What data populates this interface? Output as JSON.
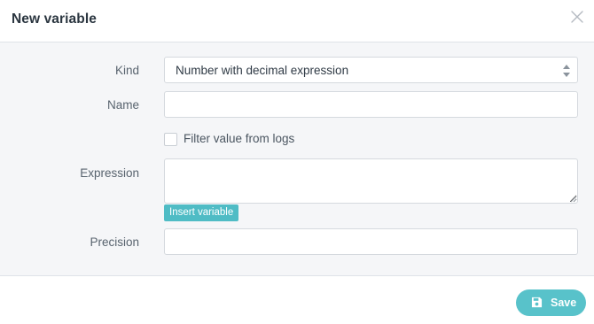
{
  "dialog": {
    "title": "New variable",
    "close_icon": "close-icon"
  },
  "form": {
    "kind": {
      "label": "Kind",
      "selected_value": "Number with decimal expression",
      "icon": "select-arrows-icon"
    },
    "name": {
      "label": "Name",
      "value": "",
      "placeholder": ""
    },
    "filter_checkbox": {
      "label": "Filter value from logs",
      "checked": false
    },
    "expression": {
      "label": "Expression",
      "value": "",
      "insert_button_label": "Insert variable"
    },
    "precision": {
      "label": "Precision",
      "value": "",
      "placeholder": ""
    }
  },
  "footer": {
    "save_label": "Save",
    "save_icon": "save-icon"
  },
  "colors": {
    "accent": "#58c2ca",
    "insert_button": "#4fbcc5",
    "body_background": "#f5f6f8",
    "border": "#d5d9de"
  }
}
